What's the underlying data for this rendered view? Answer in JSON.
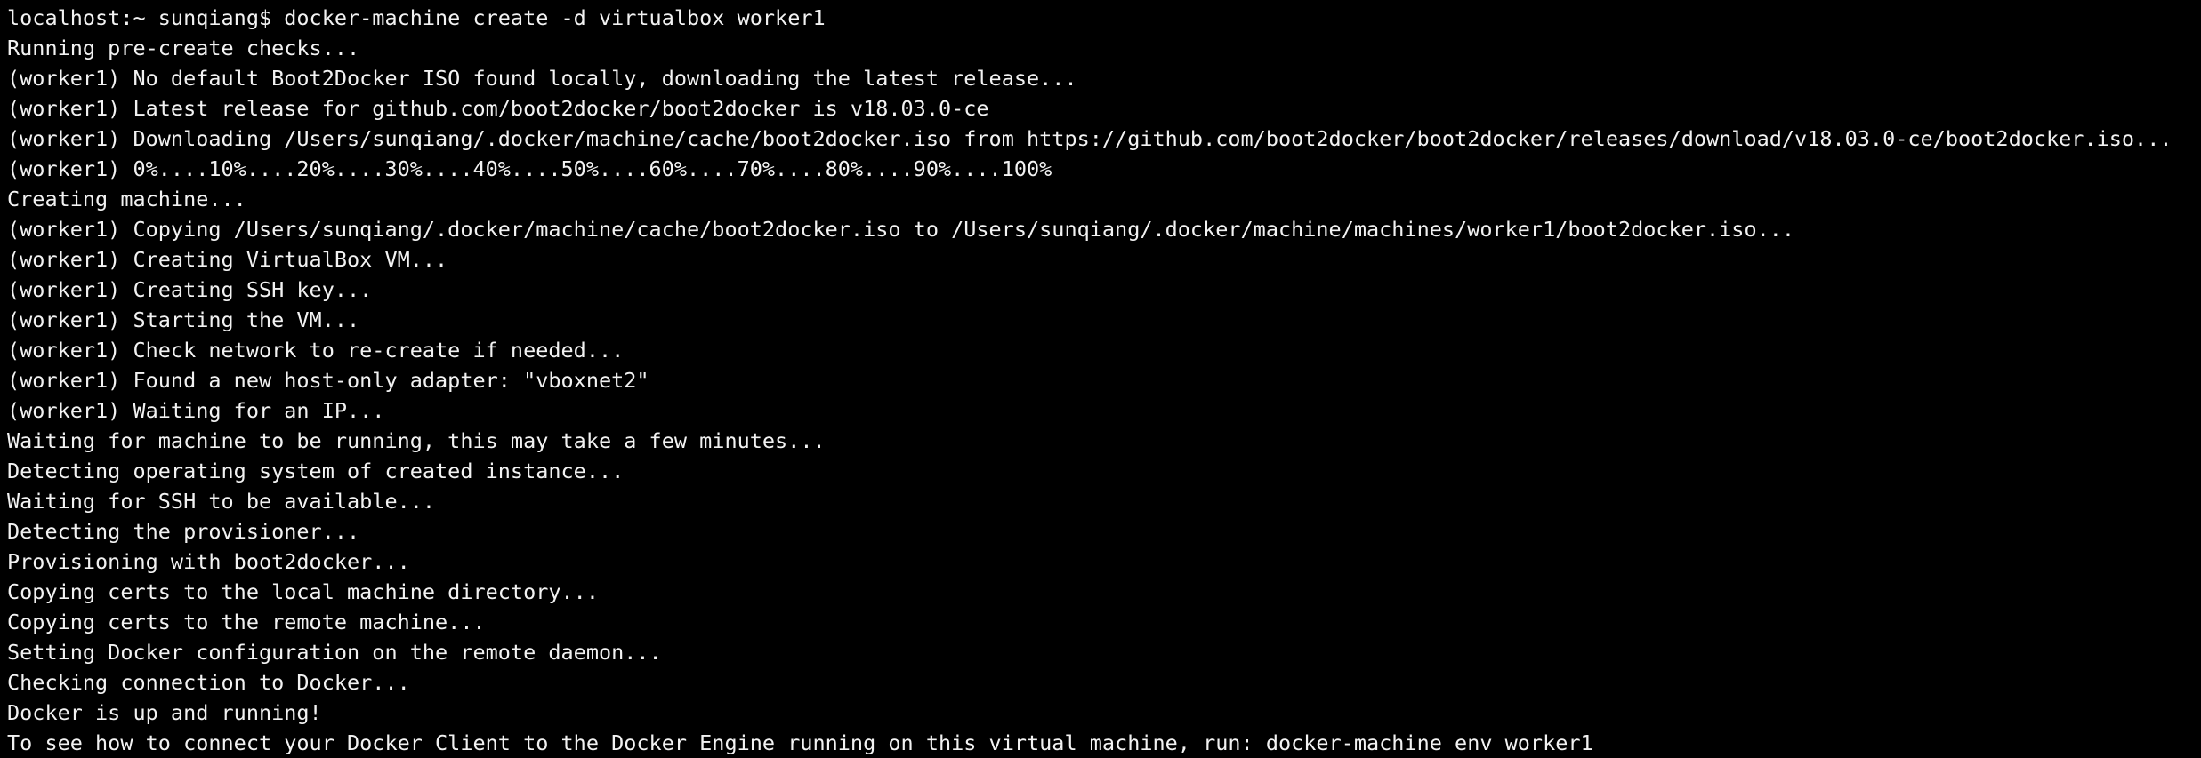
{
  "terminal": {
    "background": "#000000",
    "foreground": "#f2f2f2",
    "lines": [
      "localhost:~ sunqiang$ docker-machine create -d virtualbox worker1",
      "Running pre-create checks...",
      "(worker1) No default Boot2Docker ISO found locally, downloading the latest release...",
      "(worker1) Latest release for github.com/boot2docker/boot2docker is v18.03.0-ce",
      "(worker1) Downloading /Users/sunqiang/.docker/machine/cache/boot2docker.iso from https://github.com/boot2docker/boot2docker/releases/download/v18.03.0-ce/boot2docker.iso...",
      "(worker1) 0%....10%....20%....30%....40%....50%....60%....70%....80%....90%....100%",
      "Creating machine...",
      "(worker1) Copying /Users/sunqiang/.docker/machine/cache/boot2docker.iso to /Users/sunqiang/.docker/machine/machines/worker1/boot2docker.iso...",
      "(worker1) Creating VirtualBox VM...",
      "(worker1) Creating SSH key...",
      "(worker1) Starting the VM...",
      "(worker1) Check network to re-create if needed...",
      "(worker1) Found a new host-only adapter: \"vboxnet2\"",
      "(worker1) Waiting for an IP...",
      "Waiting for machine to be running, this may take a few minutes...",
      "Detecting operating system of created instance...",
      "Waiting for SSH to be available...",
      "Detecting the provisioner...",
      "Provisioning with boot2docker...",
      "Copying certs to the local machine directory...",
      "Copying certs to the remote machine...",
      "Setting Docker configuration on the remote daemon...",
      "Checking connection to Docker...",
      "Docker is up and running!",
      "To see how to connect your Docker Client to the Docker Engine running on this virtual machine, run: docker-machine env worker1"
    ]
  }
}
